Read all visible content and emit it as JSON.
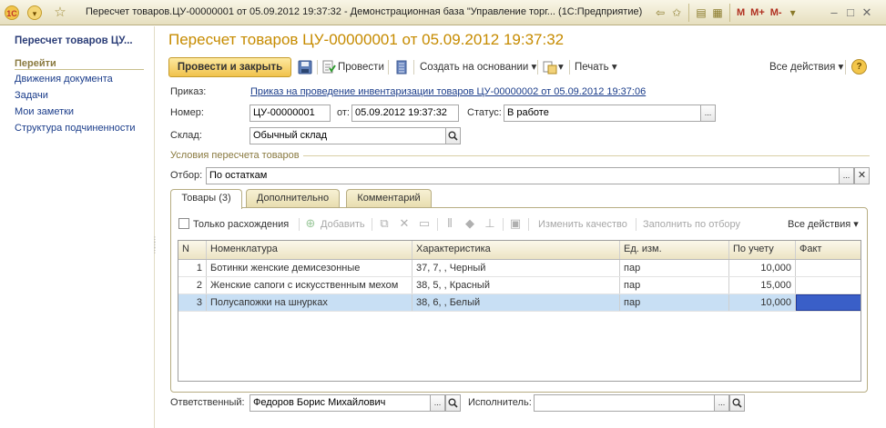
{
  "window": {
    "title": "Пересчет товаров.ЦУ-00000001 от 05.09.2012 19:37:32 - Демонстрационная база \"Управление торг...  (1С:Предприятие)",
    "logo_text": "1С",
    "mplus_labels": [
      "M",
      "M+",
      "M-"
    ],
    "window_buttons": [
      "–",
      "□",
      "✕"
    ]
  },
  "sidebar": {
    "title": "Пересчет товаров ЦУ...",
    "section": "Перейти",
    "items": [
      {
        "label": "Движения документа"
      },
      {
        "label": "Задачи"
      },
      {
        "label": "Мои заметки"
      },
      {
        "label": "Структура подчиненности"
      }
    ]
  },
  "document": {
    "title": "Пересчет товаров ЦУ-00000001 от 05.09.2012 19:37:32"
  },
  "toolbar": {
    "post_close": "Провести и закрыть",
    "post": "Провести",
    "create_based": "Создать на основании",
    "print": "Печать",
    "all_actions": "Все действия",
    "help": "?"
  },
  "form": {
    "order_label": "Приказ:",
    "order_link": "Приказ на проведение инвентаризации товаров ЦУ-00000002 от 05.09.2012 19:37:06",
    "number_label": "Номер:",
    "number_value": "ЦУ-00000001",
    "date_label": "от:",
    "date_value": "05.09.2012 19:37:32",
    "status_label": "Статус:",
    "status_value": "В работе",
    "warehouse_label": "Склад:",
    "warehouse_value": "Обычный склад",
    "conditions_group": "Условия пересчета товаров",
    "filter_label": "Отбор:",
    "filter_value": "По остаткам",
    "responsible_label": "Ответственный:",
    "responsible_value": "Федоров Борис Михайлович",
    "executor_label": "Исполнитель:",
    "executor_value": ""
  },
  "tabs": [
    {
      "label": "Товары (3)"
    },
    {
      "label": "Дополнительно"
    },
    {
      "label": "Комментарий"
    }
  ],
  "goods_toolbar": {
    "only_diff": "Только расхождения",
    "add": "Добавить",
    "change_quality": "Изменить качество",
    "fill_by_filter": "Заполнить по отбору",
    "all_actions": "Все действия"
  },
  "table": {
    "columns": [
      "N",
      "Номенклатура",
      "Характеристика",
      "Ед. изм.",
      "По учету",
      "Факт"
    ],
    "rows": [
      {
        "n": "1",
        "item": "Ботинки женские демисезонные",
        "characteristic": "37, 7, , Черный",
        "unit": "пар",
        "accounted": "10,000",
        "fact": ""
      },
      {
        "n": "2",
        "item": "Женские сапоги с искусственным мехом",
        "characteristic": "38, 5, , Красный",
        "unit": "пар",
        "accounted": "15,000",
        "fact": ""
      },
      {
        "n": "3",
        "item": "Полусапожки на шнурках",
        "characteristic": "38, 6, , Белый",
        "unit": "пар",
        "accounted": "10,000",
        "fact": ""
      }
    ],
    "selected_row": 2
  },
  "colors": {
    "accent_title": "#c68b00",
    "link": "#1a3c8a",
    "selected_row": "#c8dff4",
    "selected_cell": "#3a5fc8"
  }
}
